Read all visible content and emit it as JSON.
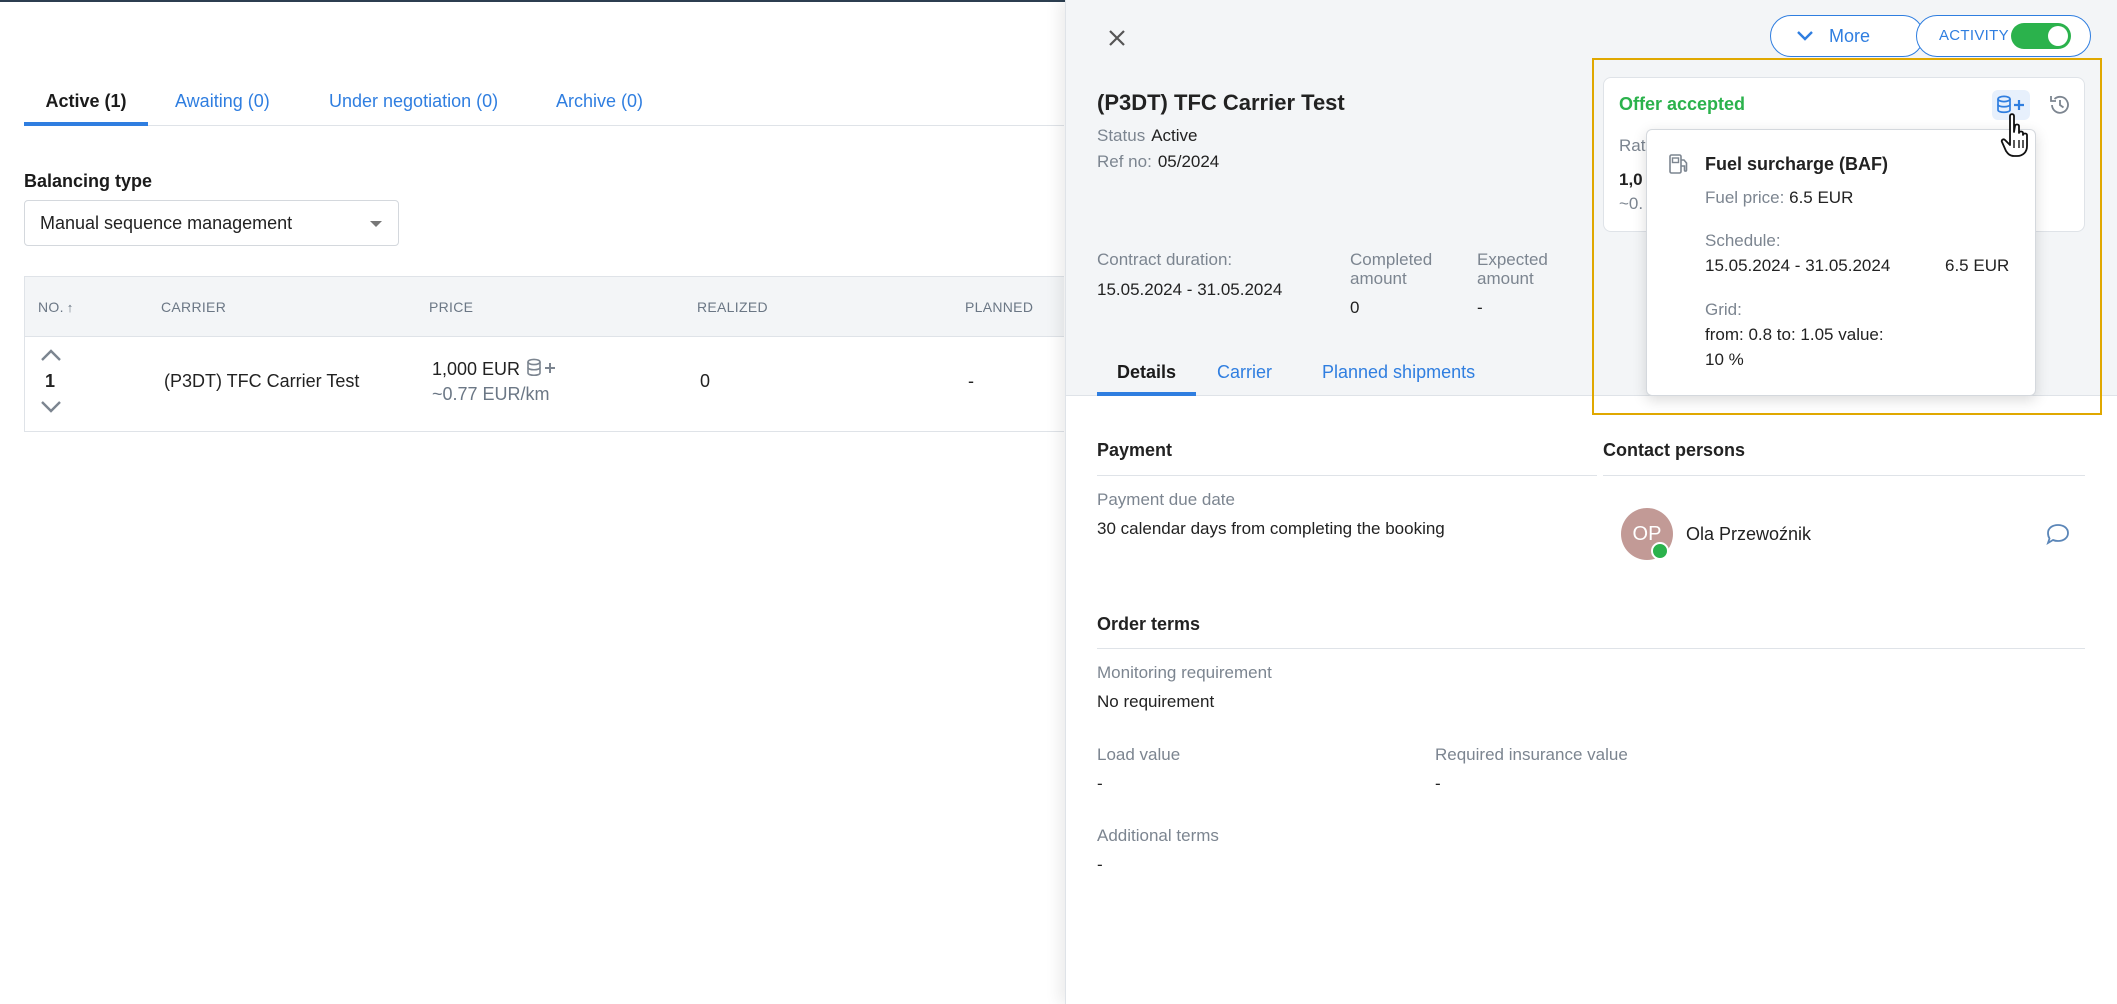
{
  "tabs": {
    "active": "Active (1)",
    "awaiting": "Awaiting (0)",
    "under_negotiation": "Under negotiation (0)",
    "archive": "Archive (0)"
  },
  "balancing": {
    "label": "Balancing type",
    "selected": "Manual sequence management"
  },
  "table": {
    "headers": {
      "no": "NO.",
      "carrier": "CARRIER",
      "price": "PRICE",
      "realized": "REALIZED",
      "planned": "PLANNED"
    },
    "rows": [
      {
        "no": "1",
        "carrier": "(P3DT) TFC Carrier Test",
        "price": "1,000 EUR",
        "price_per_km": "~0.77 EUR/km",
        "realized": "0",
        "planned": "-"
      }
    ]
  },
  "panel": {
    "more_label": "More",
    "activity_label": "ACTIVITY",
    "title": "(P3DT) TFC Carrier Test",
    "status_label": "Status",
    "status_value": "Active",
    "ref_label": "Ref no:",
    "ref_value": "05/2024",
    "contract_duration_label": "Contract duration:",
    "contract_duration_value": "15.05.2024 - 31.05.2024",
    "completed_label": "Completed amount",
    "completed_value": "0",
    "expected_label": "Expected amount",
    "expected_value": "-",
    "tabs": {
      "details": "Details",
      "carrier": "Carrier",
      "planned": "Planned shipments"
    },
    "payment": {
      "title": "Payment",
      "due_label": "Payment due date",
      "due_value": "30 calendar days from completing the booking"
    },
    "contacts": {
      "title": "Contact persons",
      "initials": "OP",
      "name": "Ola Przewoźnik"
    },
    "order_terms": {
      "title": "Order terms",
      "monitoring_label": "Monitoring requirement",
      "monitoring_value": "No requirement",
      "load_label": "Load value",
      "load_value": "-",
      "insurance_label": "Required insurance value",
      "insurance_value": "-",
      "additional_label": "Additional terms",
      "additional_value": "-"
    }
  },
  "offer": {
    "title": "Offer accepted",
    "rate_label": "Rat",
    "value": "1,0",
    "sub": "~0."
  },
  "popover": {
    "title": "Fuel surcharge (BAF)",
    "fuel_price_label": "Fuel price:",
    "fuel_price_value": "6.5 EUR",
    "schedule_label": "Schedule:",
    "schedule_range": "15.05.2024 - 31.05.2024",
    "schedule_value": "6.5 EUR",
    "grid_label": "Grid:",
    "grid_line1": "from: 0.8 to: 1.05 value:",
    "grid_line2": "10 %"
  },
  "colors": {
    "accent": "#2f7ee0",
    "success": "#2bb24c",
    "highlight": "#e0a800",
    "avatar": "#c29a96"
  },
  "icons": [
    "close-icon",
    "chevron-down-icon",
    "chevron-up-icon",
    "database-plus-icon",
    "history-icon",
    "fuel-pump-icon",
    "chat-icon",
    "hand-cursor-icon",
    "sort-arrow-up-icon"
  ]
}
